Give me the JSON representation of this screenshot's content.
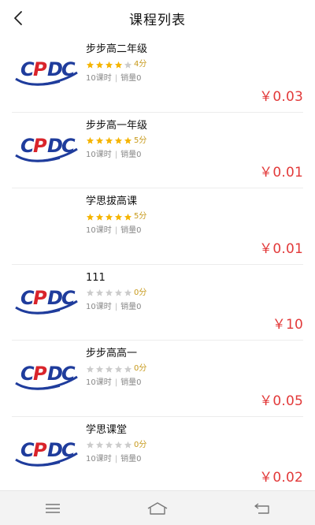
{
  "header": {
    "title": "课程列表",
    "back_icon": "chevron-left-icon"
  },
  "colors": {
    "price": "#e23a3a",
    "star_filled": "#f5b400",
    "star_empty": "#cccccc",
    "logo_blue": "#1f3c9c",
    "logo_red": "#d9242b"
  },
  "courses": [
    {
      "name": "步步高二年级",
      "rating": 4,
      "score": "4分",
      "lessons": "10课时",
      "separator": "|",
      "sales": "销量0",
      "price": "￥0.03",
      "has_logo": true
    },
    {
      "name": "步步高一年级",
      "rating": 5,
      "score": "5分",
      "lessons": "10课时",
      "separator": "|",
      "sales": "销量0",
      "price": "￥0.01",
      "has_logo": true
    },
    {
      "name": "学思拔高课",
      "rating": 5,
      "score": "5分",
      "lessons": "10课时",
      "separator": "|",
      "sales": "销量0",
      "price": "￥0.01",
      "has_logo": false
    },
    {
      "name": "111",
      "rating": 0,
      "score": "0分",
      "lessons": "10课时",
      "separator": "|",
      "sales": "销量0",
      "price": "￥10",
      "has_logo": true
    },
    {
      "name": "步步高高一",
      "rating": 0,
      "score": "0分",
      "lessons": "10课时",
      "separator": "|",
      "sales": "销量0",
      "price": "￥0.05",
      "has_logo": true
    },
    {
      "name": "学思课堂",
      "rating": 0,
      "score": "0分",
      "lessons": "10课时",
      "separator": "|",
      "sales": "销量0",
      "price": "￥0.02",
      "has_logo": true
    }
  ],
  "navbar": {
    "items": [
      "menu-icon",
      "home-icon",
      "back-icon"
    ]
  }
}
